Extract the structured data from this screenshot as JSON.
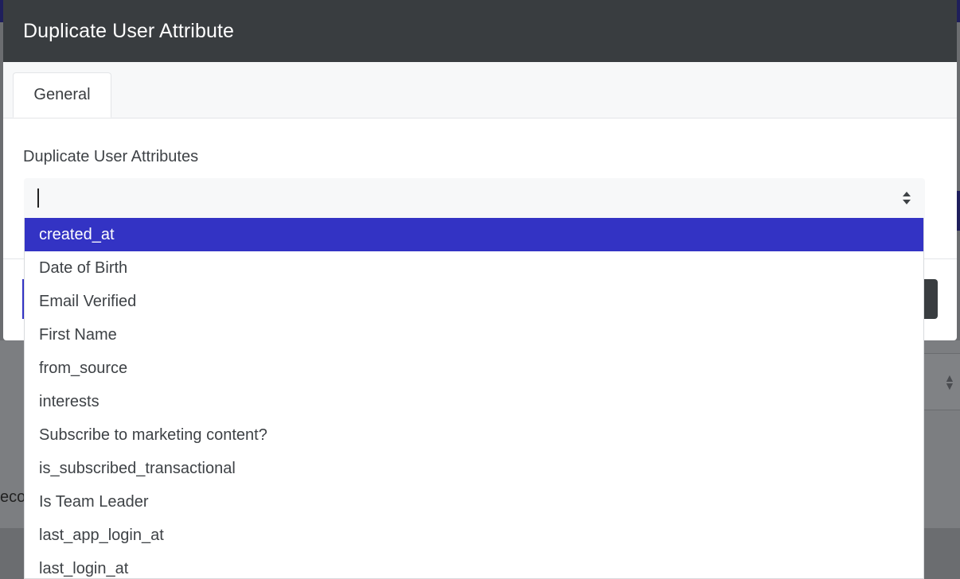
{
  "modal": {
    "title": "Duplicate User Attribute",
    "tabs": [
      {
        "label": "General",
        "active": true
      }
    ],
    "field_label": "Duplicate User Attributes",
    "select": {
      "value": "",
      "options": [
        {
          "label": "created_at",
          "highlighted": true
        },
        {
          "label": "Date of Birth"
        },
        {
          "label": "Email Verified"
        },
        {
          "label": "First Name"
        },
        {
          "label": "from_source"
        },
        {
          "label": "interests"
        },
        {
          "label": "Subscribe to marketing content?"
        },
        {
          "label": "is_subscribed_transactional"
        },
        {
          "label": "Is Team Leader"
        },
        {
          "label": "last_app_login_at"
        },
        {
          "label": "last_login_at"
        }
      ]
    }
  },
  "background": {
    "partial_text": "eco"
  },
  "colors": {
    "header_bg": "#393d40",
    "accent": "#3333c4",
    "option_text": "#3e4246"
  }
}
